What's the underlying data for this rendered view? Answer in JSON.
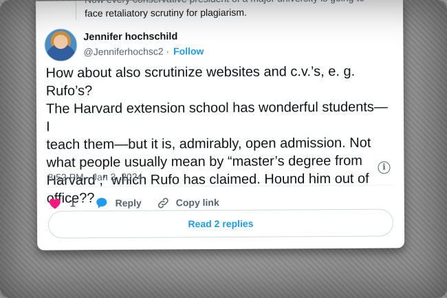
{
  "quoted_tweet": {
    "line1": "Now every conservative president of a major university is going to",
    "line2": "face retaliatory scrutiny for plagiarism."
  },
  "author": {
    "display_name": "Jennifer hochschild",
    "handle": "@Jenniferhochsc2",
    "separator": "·",
    "follow_label": "Follow",
    "avatar_icon": "profile-photo"
  },
  "tweet": {
    "text": "How about also scrutinize websites and c.v.’s, e. g. Rufo’s?\nThe Harvard extension school has wonderful students—I\nteach them—but it is, admirably, open admission. Not\nwhat people usually mean by “master’s degree from\nHarvard ,” which Rufo has claimed. Hound him out of\noffice??",
    "timestamp": "8:52 PM · Jan 3, 2024"
  },
  "actions": {
    "like_count": "1",
    "reply_label": "Reply",
    "copy_link_label": "Copy link",
    "like_color": "#f91880",
    "reply_color": "#1d9bf0"
  },
  "read_replies_label": "Read 2 replies",
  "colors": {
    "accent": "#1d9bf0",
    "text": "#0f1419",
    "muted": "#536471"
  }
}
